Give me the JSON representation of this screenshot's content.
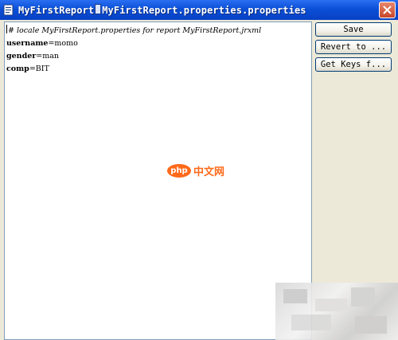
{
  "window": {
    "title_parts": [
      "MyFirstReport",
      "MyFirstReport.properties",
      ".properties"
    ]
  },
  "editor": {
    "lines": [
      {
        "text": "# locale MyFirstReport.properties for report MyFirstReport.jrxml",
        "kind": "comment"
      },
      {
        "key": "username",
        "value": "=momo"
      },
      {
        "key": "gender",
        "value": "=man"
      },
      {
        "key": "comp",
        "value": "=BIT"
      }
    ]
  },
  "buttons": {
    "save": "Save",
    "revert": "Revert to ...",
    "get_keys": "Get Keys f..."
  },
  "watermark": {
    "logo": "php",
    "text": "中文网"
  },
  "colors": {
    "titlebar": "#0a4fd6",
    "close": "#c8452a",
    "panel": "#ece9d8",
    "watermark": "#ff6a1a"
  },
  "icons": {
    "app": "document-icon",
    "close": "close-x-icon"
  }
}
